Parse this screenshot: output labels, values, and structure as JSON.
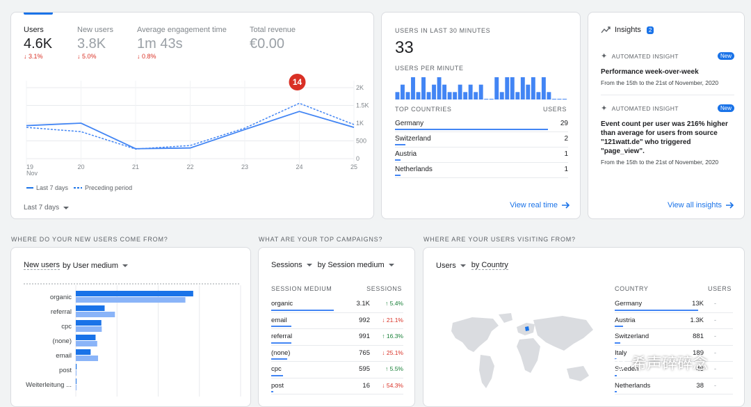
{
  "overview": {
    "metrics": [
      {
        "label": "Users",
        "value": "4.6K",
        "change": "↓ 3.1%",
        "active": true
      },
      {
        "label": "New users",
        "value": "3.8K",
        "change": "↓ 5.0%",
        "active": false
      },
      {
        "label": "Average engagement time",
        "value": "1m 43s",
        "change": "↓ 0.8%",
        "active": false
      },
      {
        "label": "Total revenue",
        "value": "€0.00",
        "change": "",
        "active": false
      }
    ],
    "badge": "14",
    "date_range": "Last 7 days",
    "legend": {
      "current": "Last 7 days",
      "previous": "Preceding period"
    }
  },
  "chart_data": {
    "type": "line",
    "x": [
      "19",
      "20",
      "21",
      "22",
      "23",
      "24",
      "25"
    ],
    "x_sublabel": "Nov",
    "y_ticks": [
      "2K",
      "1.5K",
      "1K",
      "500",
      "0"
    ],
    "ylim": [
      0,
      2000
    ],
    "series": [
      {
        "name": "Last 7 days",
        "values": [
          930,
          1000,
          280,
          300,
          820,
          1330,
          880
        ],
        "color": "#4285f4",
        "style": "solid"
      },
      {
        "name": "Preceding period",
        "values": [
          880,
          760,
          270,
          370,
          860,
          1560,
          960
        ],
        "color": "#4285f4",
        "style": "dashed"
      }
    ]
  },
  "realtime": {
    "title": "USERS IN LAST 30 MINUTES",
    "value": "33",
    "per_minute_label": "USERS PER MINUTE",
    "per_minute": [
      1,
      2,
      1,
      3,
      1,
      3,
      1,
      2,
      3,
      2,
      1,
      1,
      2,
      1,
      2,
      1,
      2,
      0,
      0,
      3,
      1,
      3,
      3,
      1,
      3,
      2,
      3,
      1,
      3,
      1,
      0,
      0,
      0
    ],
    "countries_header": "TOP COUNTRIES",
    "users_header": "USERS",
    "countries": [
      {
        "name": "Germany",
        "value": "29",
        "frac": 1.0
      },
      {
        "name": "Switzerland",
        "value": "2",
        "frac": 0.07
      },
      {
        "name": "Austria",
        "value": "1",
        "frac": 0.035
      },
      {
        "name": "Netherlands",
        "value": "1",
        "frac": 0.035
      }
    ],
    "link": "View real time"
  },
  "insights": {
    "title": "Insights",
    "count": "2",
    "items": [
      {
        "tag": "AUTOMATED INSIGHT",
        "badge": "New",
        "title": "Performance week-over-week",
        "date": "From the 15th to the 21st of November, 2020"
      },
      {
        "tag": "AUTOMATED INSIGHT",
        "badge": "New",
        "title": "Event count per user was 216% higher than average for users from source \"121watt.de\" who triggered \"page_view\".",
        "date": "From the 15th to the 21st of November, 2020"
      }
    ],
    "link": "View all insights"
  },
  "sections": {
    "new_users": "WHERE DO YOUR NEW USERS COME FROM?",
    "campaigns": "WHAT ARE YOUR TOP CAMPAIGNS?",
    "visiting": "WHERE ARE YOUR USERS VISITING FROM?"
  },
  "medium_chart": {
    "title_metric": "New users",
    "title_dim": "by User medium",
    "categories": [
      "organic",
      "referral",
      "cpc",
      "(none)",
      "email",
      "post",
      "Weiterleitung ..."
    ],
    "current": [
      2850,
      700,
      620,
      480,
      360,
      20,
      0
    ],
    "previous": [
      2660,
      950,
      630,
      520,
      540,
      15,
      0
    ],
    "xmax": 4000
  },
  "campaigns": {
    "metric": "Sessions",
    "dim": "by Session medium",
    "col1": "SESSION MEDIUM",
    "col2": "SESSIONS",
    "rows": [
      {
        "name": "organic",
        "value": "3.1K",
        "change": "↑ 5.4%",
        "dir": "up",
        "frac": 1.0
      },
      {
        "name": "email",
        "value": "992",
        "change": "↓ 21.1%",
        "dir": "down",
        "frac": 0.32
      },
      {
        "name": "referral",
        "value": "991",
        "change": "↑ 16.3%",
        "dir": "up",
        "frac": 0.32
      },
      {
        "name": "(none)",
        "value": "765",
        "change": "↓ 25.1%",
        "dir": "down",
        "frac": 0.25
      },
      {
        "name": "cpc",
        "value": "595",
        "change": "↑ 5.5%",
        "dir": "up",
        "frac": 0.19
      },
      {
        "name": "post",
        "value": "16",
        "change": "↓ 54.3%",
        "dir": "down",
        "frac": 0.01
      }
    ]
  },
  "countries": {
    "metric": "Users",
    "dim": "by Country",
    "col1": "COUNTRY",
    "col2": "USERS",
    "rows": [
      {
        "name": "Germany",
        "value": "13K",
        "change": "-",
        "frac": 1.0
      },
      {
        "name": "Austria",
        "value": "1.3K",
        "change": "-",
        "frac": 0.1
      },
      {
        "name": "Switzerland",
        "value": "881",
        "change": "-",
        "frac": 0.07
      },
      {
        "name": "Italy",
        "value": "189",
        "change": "-",
        "frac": 0.015
      },
      {
        "name": "Sweden",
        "value": "49",
        "change": "-",
        "frac": 0.005
      },
      {
        "name": "Netherlands",
        "value": "38",
        "change": "-",
        "frac": 0.004
      }
    ]
  },
  "watermark": "希声碎碎念"
}
